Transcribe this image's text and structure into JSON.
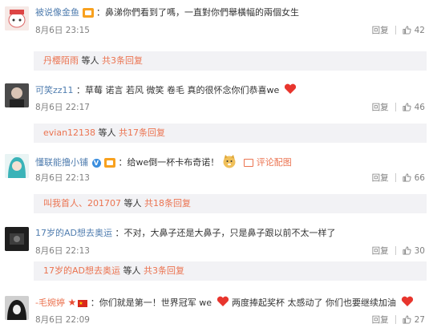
{
  "comments": [
    {
      "user": "被说像金鱼",
      "text": "：鼻涕你們看到了嗎，一直對你們舉橫幅的兩個女生",
      "time": "8月6日 23:15",
      "reply_label": "回复",
      "likes": "42",
      "thread": {
        "user": "丹樱陌雨",
        "middle": " 等人 ",
        "count": "共3条回复"
      }
    },
    {
      "user": "可笑zz11",
      "text": "：草莓 诺言 若风 微笑 卷毛  真的很怀念你们恭喜we",
      "time": "8月6日 22:17",
      "reply_label": "回复",
      "likes": "46",
      "thread": {
        "user": "evian12138",
        "middle": " 等人 ",
        "count": "共17条回复"
      }
    },
    {
      "user": "懂联能撸小铺",
      "text": "：给we倒一杯卡布奇诺！",
      "extra": "评论配图",
      "time": "8月6日 22:13",
      "reply_label": "回复",
      "likes": "66",
      "thread": {
        "user": "叫我首人、201707",
        "middle": " 等人 ",
        "count": "共18条回复"
      }
    },
    {
      "user": "17岁的AD想去奥运",
      "text": "：不对，大鼻子还是大鼻子，只是鼻子跟以前不太一样了",
      "time": "8月6日 22:13",
      "reply_label": "回复",
      "likes": "30",
      "thread": {
        "user": "17岁的AD想去奥运",
        "middle": " 等人 ",
        "count": "共3条回复"
      }
    },
    {
      "user": "-毛婉婷",
      "text_a": "：你们就是第一！世界冠军 we",
      "text_b": "两度捧起奖杯 太感动了 你们也要继续加油",
      "time": "8月6日 22:09",
      "reply_label": "回复",
      "likes": "27"
    }
  ],
  "colors": {
    "link": "#eb7350",
    "name": "#507daf",
    "meta": "#808080",
    "reply_bg": "#f2f2f5",
    "heart": "#e8352d"
  }
}
